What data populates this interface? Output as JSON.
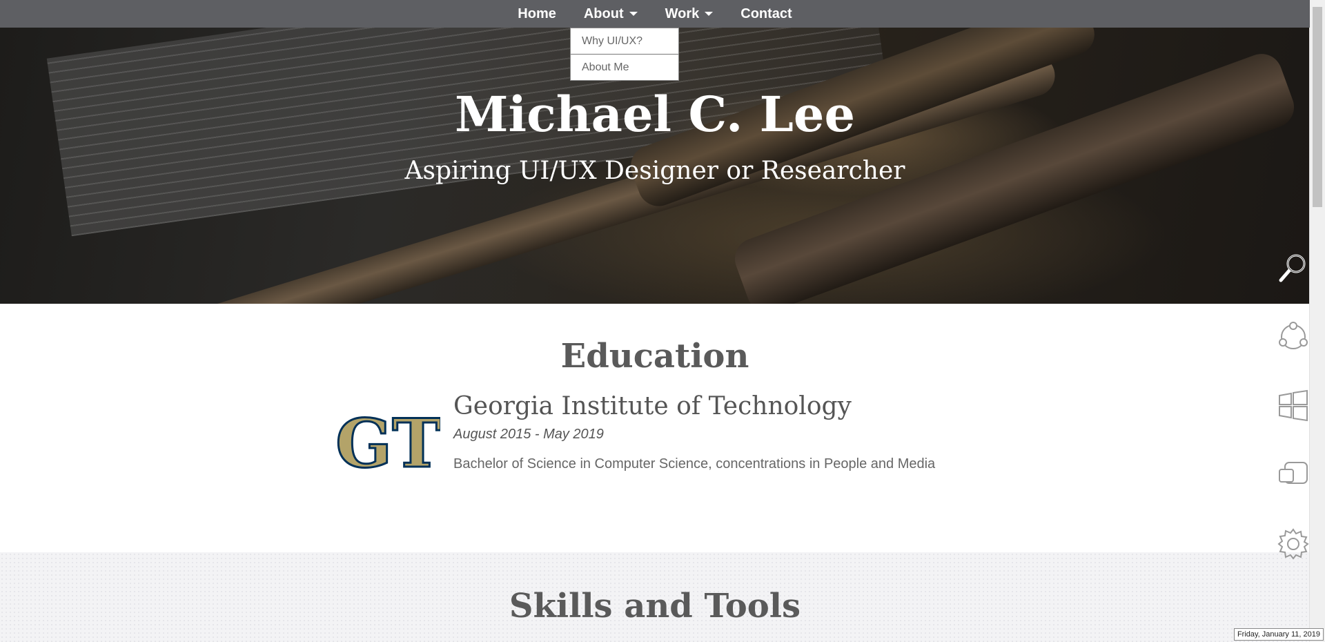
{
  "nav": {
    "items": [
      {
        "label": "Home",
        "has_dropdown": false
      },
      {
        "label": "About",
        "has_dropdown": true
      },
      {
        "label": "Work",
        "has_dropdown": true
      },
      {
        "label": "Contact",
        "has_dropdown": false
      }
    ],
    "about_dropdown": [
      "Why UI/UX?",
      "About Me"
    ]
  },
  "hero": {
    "title": "Michael C. Lee",
    "subtitle": "Aspiring UI/UX Designer or Researcher"
  },
  "education": {
    "heading": "Education",
    "school": "Georgia Institute of Technology",
    "dates": "August 2015 - May 2019",
    "degree": "Bachelor of Science in Computer Science, concentrations in People and Media",
    "logo_text": "GT"
  },
  "skills": {
    "heading": "Skills and Tools"
  },
  "side_icons": [
    "search-icon",
    "network-icon",
    "windows-icon",
    "devices-icon",
    "gear-icon"
  ],
  "date_stamp": "Friday, January 11, 2019",
  "colors": {
    "navbar": "#5e5f63",
    "gt_gold": "#b3a369",
    "gt_navy": "#003057"
  }
}
